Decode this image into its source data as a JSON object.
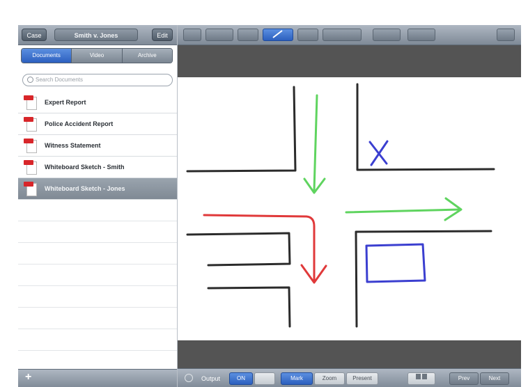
{
  "sidebar": {
    "back_label": "Case",
    "case_title": "Smith v. Jones",
    "edit_label": "Edit",
    "segments": [
      "Documents",
      "Video",
      "Archive"
    ],
    "active_segment": 0,
    "search_placeholder": "Search Documents",
    "documents": [
      {
        "label": "Expert Report"
      },
      {
        "label": "Police Accident Report"
      },
      {
        "label": "Witness Statement"
      },
      {
        "label": "Whiteboard Sketch - Smith"
      },
      {
        "label": "Whiteboard Sketch - Jones"
      }
    ],
    "selected_index": 4,
    "add_label": "+"
  },
  "toolbar": {
    "tools": [
      "",
      "",
      "",
      "",
      "",
      "",
      "",
      ""
    ],
    "active_tool": 3
  },
  "bottombar": {
    "output_label": "Output",
    "output_on": "ON",
    "output_off": "",
    "mode_buttons": [
      "Mark",
      "Zoom",
      "Present"
    ],
    "active_mode": 0,
    "nav_buttons": [
      "Prev",
      "Next"
    ]
  },
  "colors": {
    "accent_blue": "#2c5fbf",
    "stroke_black": "#2b2b2b",
    "stroke_green": "#5fd45f",
    "stroke_red": "#e0393a",
    "stroke_blue": "#3b3fd0"
  }
}
